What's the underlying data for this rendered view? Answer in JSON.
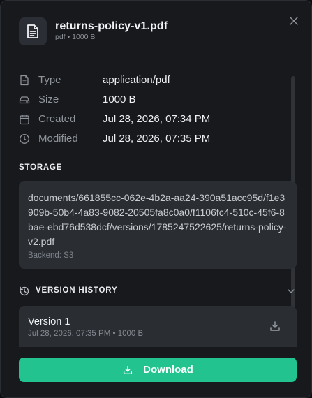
{
  "file": {
    "name": "returns-policy-v1.pdf",
    "subtitle": "pdf • 1000 B"
  },
  "properties": [
    {
      "icon": "document-icon",
      "label": "Type",
      "value": "application/pdf"
    },
    {
      "icon": "drive-icon",
      "label": "Size",
      "value": "1000 B"
    },
    {
      "icon": "calendar-icon",
      "label": "Created",
      "value": "Jul 28, 2026, 07:34 PM"
    },
    {
      "icon": "clock-icon",
      "label": "Modified",
      "value": "Jul 28, 2026, 07:35 PM"
    }
  ],
  "storage": {
    "title": "STORAGE",
    "path": "documents/661855cc-062e-4b2a-aa24-390a51acc95d/f1e3909b-50b4-4a83-9082-20505fa8c0a0/f1106fc4-510c-45f6-8bae-ebd76d538dcf/versions/1785247522625/returns-policy-v2.pdf",
    "backend": "Backend: S3"
  },
  "version_history": {
    "title": "VERSION HISTORY",
    "versions": [
      {
        "name": "Version 1",
        "meta": "Jul 28, 2026, 07:35 PM • 1000 B"
      }
    ]
  },
  "footer": {
    "download_label": "Download"
  },
  "colors": {
    "accent": "#22c38e",
    "background": "#17191d",
    "card": "#2a2e33"
  }
}
